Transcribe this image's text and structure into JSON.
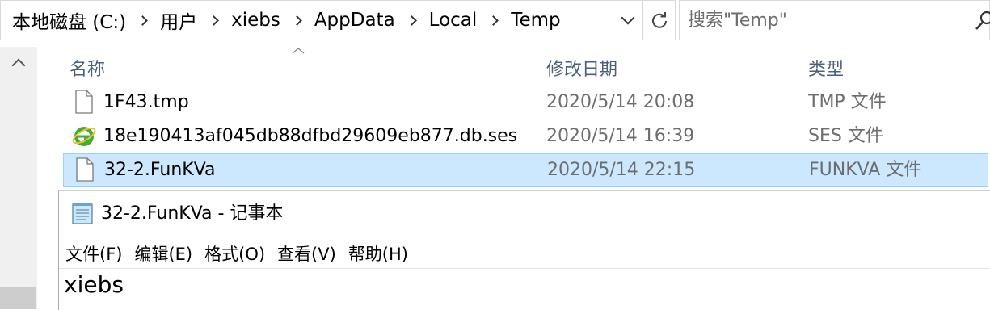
{
  "address": {
    "crumbs": [
      "本地磁盘 (C:)",
      "用户",
      "xiebs",
      "AppData",
      "Local",
      "Temp"
    ]
  },
  "search": {
    "placeholder": "搜索\"Temp\""
  },
  "columns": {
    "name": "名称",
    "modified": "修改日期",
    "type": "类型"
  },
  "files": [
    {
      "name": "1F43.tmp",
      "modified": "2020/5/14 20:08",
      "type": "TMP 文件",
      "icon": "blank-file-icon",
      "selected": false
    },
    {
      "name": "18e190413af045db88dfbd29609eb877.db.ses",
      "modified": "2020/5/14 16:39",
      "type": "SES 文件",
      "icon": "ie-file-icon",
      "selected": false
    },
    {
      "name": "32-2.FunKVa",
      "modified": "2020/5/14 22:15",
      "type": "FUNKVA 文件",
      "icon": "blank-file-icon",
      "selected": true
    }
  ],
  "notepad": {
    "title": "32-2.FunKVa - 记事本",
    "menu": [
      "文件(F)",
      "编辑(E)",
      "格式(O)",
      "查看(V)",
      "帮助(H)"
    ],
    "content": "xiebs",
    "icon": "notepad-icon"
  },
  "colors": {
    "selection": "#cce8ff",
    "selection_border": "#99d1ff",
    "header_text": "#4c607a"
  }
}
